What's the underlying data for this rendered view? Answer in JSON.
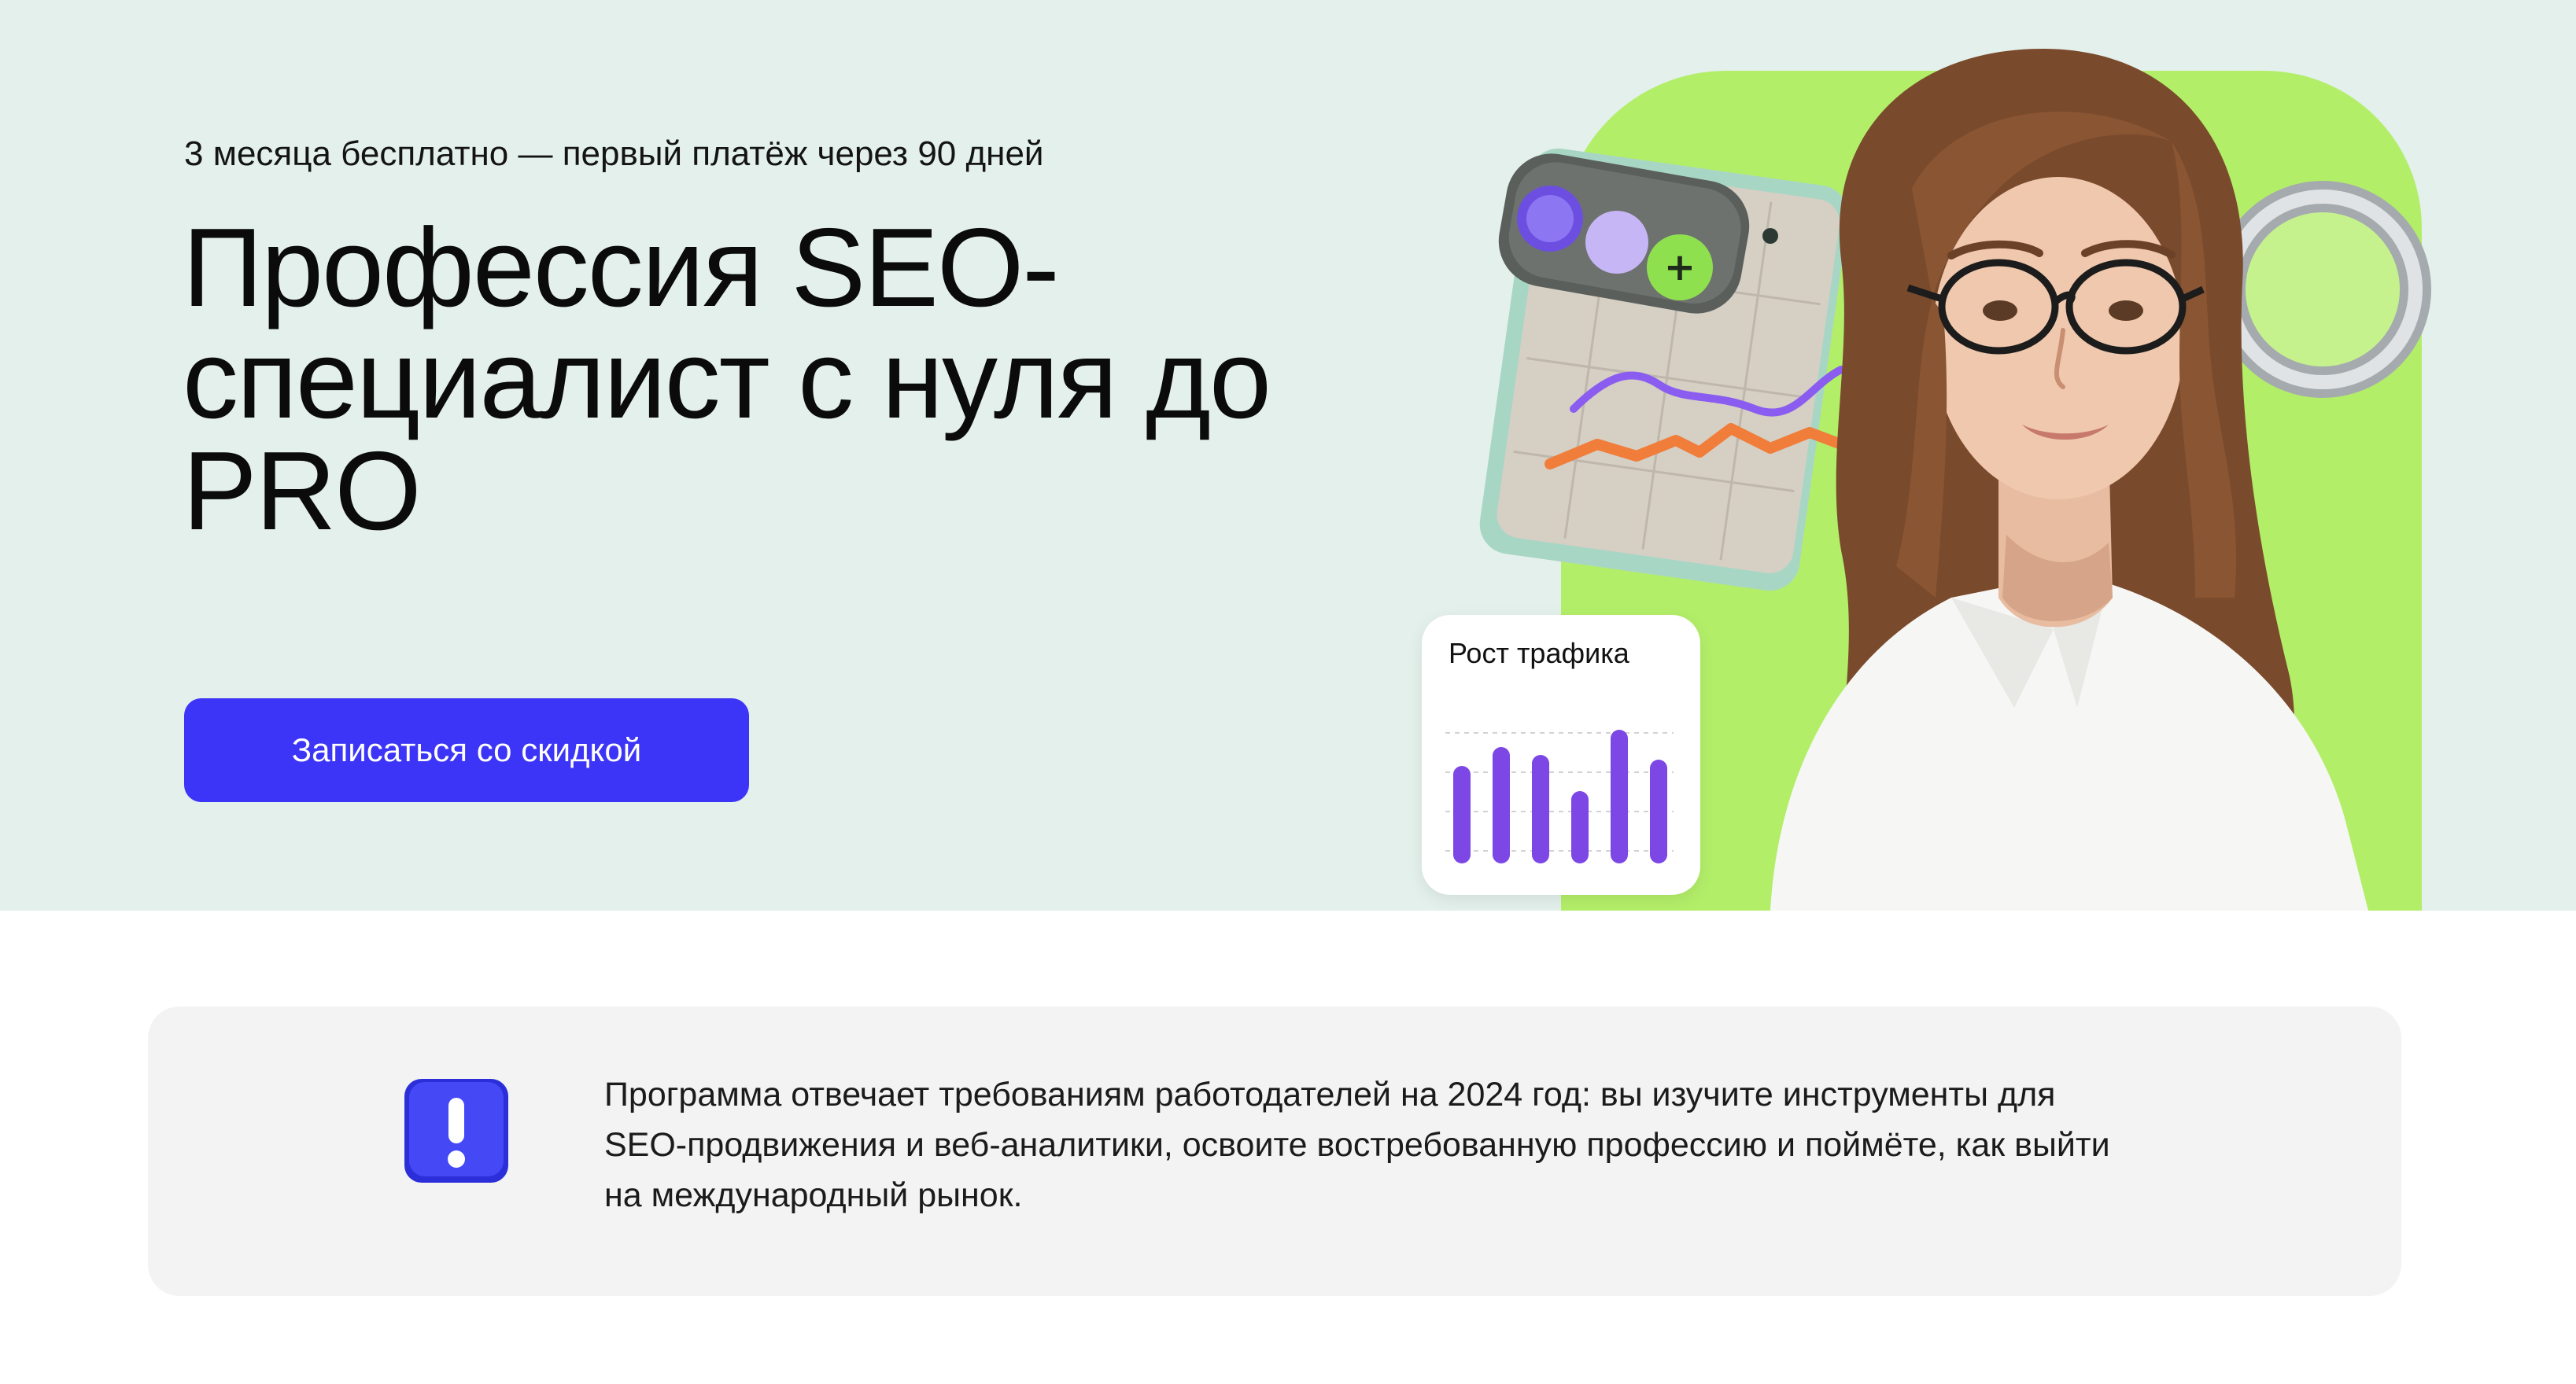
{
  "promo": {
    "text": "3 месяца бесплатно — первый платёж через 90 дней"
  },
  "hero": {
    "title": "Профессия SEO-специалист с нуля до PRO",
    "cta_label": "Записаться со скидкой"
  },
  "traffic_card": {
    "title": "Рост трафика"
  },
  "notice": {
    "icon": "exclamation-icon",
    "text": "Программа отвечает требованиям работодателей на 2024 год: вы изучите инструменты для SEO-продвижения и веб-аналитики, освоите востребованную профессию и поймёте, как выйти на международный рынок."
  },
  "colors": {
    "hero_background": "#e3f0eb",
    "accent_green": "#b3ee69",
    "button_blue": "#3c35f7",
    "bar_purple": "#7c47e4",
    "notice_background": "#f3f3f3"
  }
}
